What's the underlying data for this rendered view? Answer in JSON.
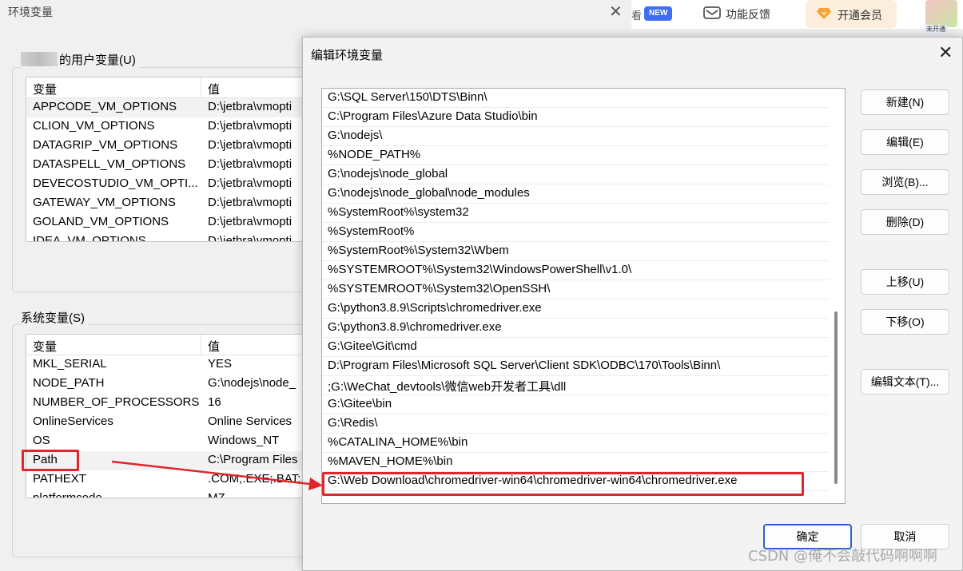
{
  "background_window": {
    "title": "环境变量",
    "user_vars": {
      "label": "的用户变量(U)",
      "headers": [
        "变量",
        "值"
      ],
      "rows": [
        [
          "APPCODE_VM_OPTIONS",
          "D:\\jetbra\\vmopti"
        ],
        [
          "CLION_VM_OPTIONS",
          "D:\\jetbra\\vmopti"
        ],
        [
          "DATAGRIP_VM_OPTIONS",
          "D:\\jetbra\\vmopti"
        ],
        [
          "DATASPELL_VM_OPTIONS",
          "D:\\jetbra\\vmopti"
        ],
        [
          "DEVECOSTUDIO_VM_OPTI...",
          "D:\\jetbra\\vmopti"
        ],
        [
          "GATEWAY_VM_OPTIONS",
          "D:\\jetbra\\vmopti"
        ],
        [
          "GOLAND_VM_OPTIONS",
          "D:\\jetbra\\vmopti"
        ],
        [
          "IDEA_VM_OPTIONS",
          "D:\\jetbra\\vmopti"
        ]
      ]
    },
    "system_vars": {
      "label": "系统变量(S)",
      "headers": [
        "变量",
        "值"
      ],
      "rows": [
        [
          "MKL_SERIAL",
          "YES"
        ],
        [
          "NODE_PATH",
          "G:\\nodejs\\node_"
        ],
        [
          "NUMBER_OF_PROCESSORS",
          "16"
        ],
        [
          "OnlineServices",
          "Online Services"
        ],
        [
          "OS",
          "Windows_NT"
        ],
        [
          "Path",
          "C:\\Program Files"
        ],
        [
          "PATHEXT",
          ".COM;.EXE;.BAT;."
        ],
        [
          "platformcode",
          "MZ"
        ]
      ]
    }
  },
  "topbar": {
    "cut_char": "看",
    "new_badge": "NEW",
    "feedback_label": "功能反馈",
    "vip_label": "开通会员",
    "avatar_tag": "未开通"
  },
  "dialog": {
    "title": "编辑环境变量",
    "paths": [
      "G:\\SQL Server\\150\\DTS\\Binn\\",
      "C:\\Program Files\\Azure Data Studio\\bin",
      "G:\\nodejs\\",
      "%NODE_PATH%",
      "G:\\nodejs\\node_global",
      "G:\\nodejs\\node_global\\node_modules",
      "%SystemRoot%\\system32",
      "%SystemRoot%",
      "%SystemRoot%\\System32\\Wbem",
      "%SYSTEMROOT%\\System32\\WindowsPowerShell\\v1.0\\",
      "%SYSTEMROOT%\\System32\\OpenSSH\\",
      "G:\\python3.8.9\\Scripts\\chromedriver.exe",
      "G:\\python3.8.9\\chromedriver.exe",
      "G:\\Gitee\\Git\\cmd",
      "D:\\Program Files\\Microsoft SQL Server\\Client SDK\\ODBC\\170\\Tools\\Binn\\",
      ";G:\\WeChat_devtools\\微信web开发者工具\\dll",
      "G:\\Gitee\\bin",
      "G:\\Redis\\",
      "%CATALINA_HOME%\\bin",
      "%MAVEN_HOME%\\bin",
      "G:\\Web Download\\chromedriver-win64\\chromedriver-win64\\chromedriver.exe"
    ],
    "buttons": {
      "new": "新建(N)",
      "edit": "编辑(E)",
      "browse": "浏览(B)...",
      "delete": "删除(D)",
      "move_up": "上移(U)",
      "move_down": "下移(O)",
      "edit_text": "编辑文本(T)...",
      "ok": "确定",
      "cancel": "取消"
    }
  },
  "watermark": "CSDN @俺不会敲代码啊啊啊",
  "colors": {
    "highlight": "#e0262b",
    "accent": "#2a62c9",
    "new_badge": "#3f6ff0"
  }
}
